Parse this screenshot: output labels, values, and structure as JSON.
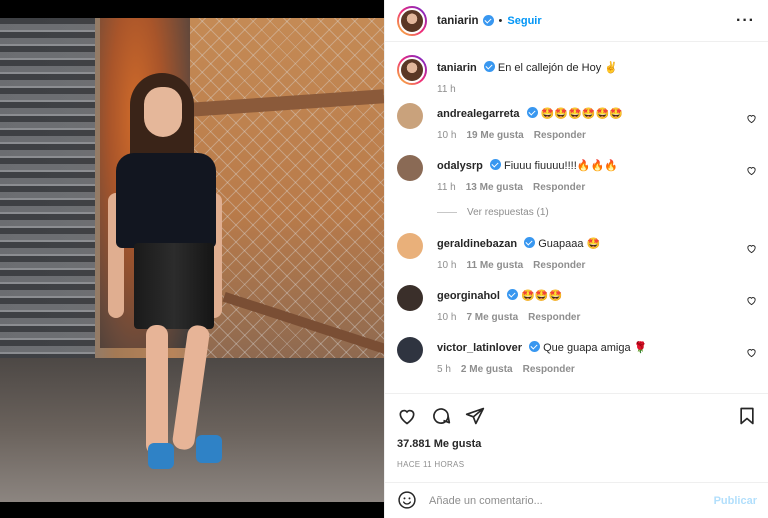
{
  "post": {
    "username": "taniarin",
    "follow_label": "Seguir",
    "caption": "En el callejón de Hoy ✌️",
    "caption_time": "11 h",
    "likes": "37.881",
    "likes_suffix": "Me gusta",
    "posted_ago": "HACE 11 HORAS"
  },
  "comments": [
    {
      "user": "andrealegarreta",
      "text": "🤩🤩🤩🤩🤩🤩",
      "time": "10 h",
      "likes": "19 Me gusta",
      "reply": "Responder",
      "avatar_color": "#c9a27c"
    },
    {
      "user": "odalysrp",
      "text": "Fiuuu fiuuuu!!!!🔥🔥🔥",
      "time": "11 h",
      "likes": "13 Me gusta",
      "reply": "Responder",
      "avatar_color": "#8a6a55"
    },
    {
      "user": "geraldinebazan",
      "text": "Guapaaa 🤩",
      "time": "10 h",
      "likes": "11 Me gusta",
      "reply": "Responder",
      "avatar_color": "#e9b07a"
    },
    {
      "user": "georginahol",
      "text": "🤩🤩🤩",
      "time": "10 h",
      "likes": "7 Me gusta",
      "reply": "Responder",
      "avatar_color": "#3a2f2a"
    },
    {
      "user": "victor_latinlover",
      "text": "Que guapa amiga 🌹",
      "time": "5 h",
      "likes": "2 Me gusta",
      "reply": "Responder",
      "avatar_color": "#2f3440"
    }
  ],
  "view_replies": "Ver respuestas (1)",
  "add_comment": {
    "placeholder": "Añade un comentario...",
    "publish_label": "Publicar"
  },
  "colors": {
    "accent": "#0095f6",
    "verified": "#3897f0",
    "muted": "#8e8e8e",
    "publish_disabled": "#b2dffc"
  },
  "icons": [
    "heart-icon",
    "comment-icon",
    "share-icon",
    "bookmark-icon",
    "emoji-icon",
    "more-icon",
    "verified-icon"
  ]
}
